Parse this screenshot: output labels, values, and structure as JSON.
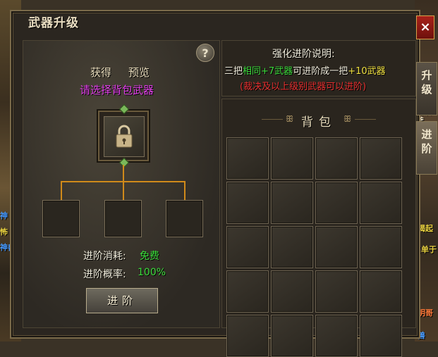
{
  "window": {
    "title": "武器升级",
    "close_label": "×"
  },
  "side_tabs": [
    {
      "label": "升级"
    },
    {
      "label": "进阶"
    }
  ],
  "left": {
    "help_label": "?",
    "obtain_label": "获得",
    "preview_label": "预览",
    "prompt": "请选择背包武器",
    "cost_label": "进阶消耗:",
    "cost_value": "免费",
    "rate_label": "进阶概率:",
    "rate_value": "100%",
    "advance_button": "进阶"
  },
  "info": {
    "title": "强化进阶说明:",
    "line_prefix": "三把",
    "line_same": "相同+7武器",
    "line_mid": "可进阶成一把",
    "line_plus": "+10武器",
    "note": "(裁决及以上级别武器可以进阶)"
  },
  "bag": {
    "title": "背包",
    "rows": 5,
    "cols": 4
  },
  "background_fragments": [
    "神",
    "怖",
    "神兽",
    "喝起",
    "(单于",
    "明哥",
    "兽",
    "之滔斧"
  ],
  "colors": {
    "prompt_magenta": "#e040e8",
    "value_green": "#3cdc3c",
    "note_red": "#e83030",
    "plus_yellow": "#f0e040",
    "connector_orange": "#d08a1a"
  },
  "icons": [
    "lock-icon",
    "question-icon",
    "close-icon"
  ]
}
